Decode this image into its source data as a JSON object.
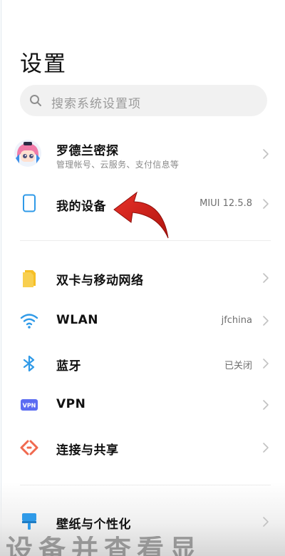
{
  "page": {
    "title": "设置"
  },
  "search": {
    "placeholder": "搜索系统设置项"
  },
  "account": {
    "name": "罗德兰密探",
    "subtitle": "管理帐号、云服务、支付信息等"
  },
  "device": {
    "label": "我的设备",
    "value": "MIUI 12.5.8"
  },
  "network_items": [
    {
      "label": "双卡与移动网络",
      "value": "",
      "icon": "sim-card-icon"
    },
    {
      "label": "WLAN",
      "value": "jfchina",
      "icon": "wifi-icon"
    },
    {
      "label": "蓝牙",
      "value": "已关闭",
      "icon": "bluetooth-icon"
    },
    {
      "label": "VPN",
      "value": "",
      "icon": "vpn-icon"
    },
    {
      "label": "连接与共享",
      "value": "",
      "icon": "connection-share-icon"
    }
  ],
  "personal_items": [
    {
      "label": "壁纸与个性化",
      "icon": "wallpaper-icon"
    }
  ],
  "overlay": {
    "caption": "设备并查看显"
  },
  "icons": {
    "vpn_badge": "VPN"
  },
  "colors": {
    "accent_blue": "#2f9ae8",
    "sim_yellow": "#f6bf26",
    "vpn_purple": "#5b6cf2",
    "share_orange": "#f0694f",
    "annotation_red": "#d9261c"
  }
}
